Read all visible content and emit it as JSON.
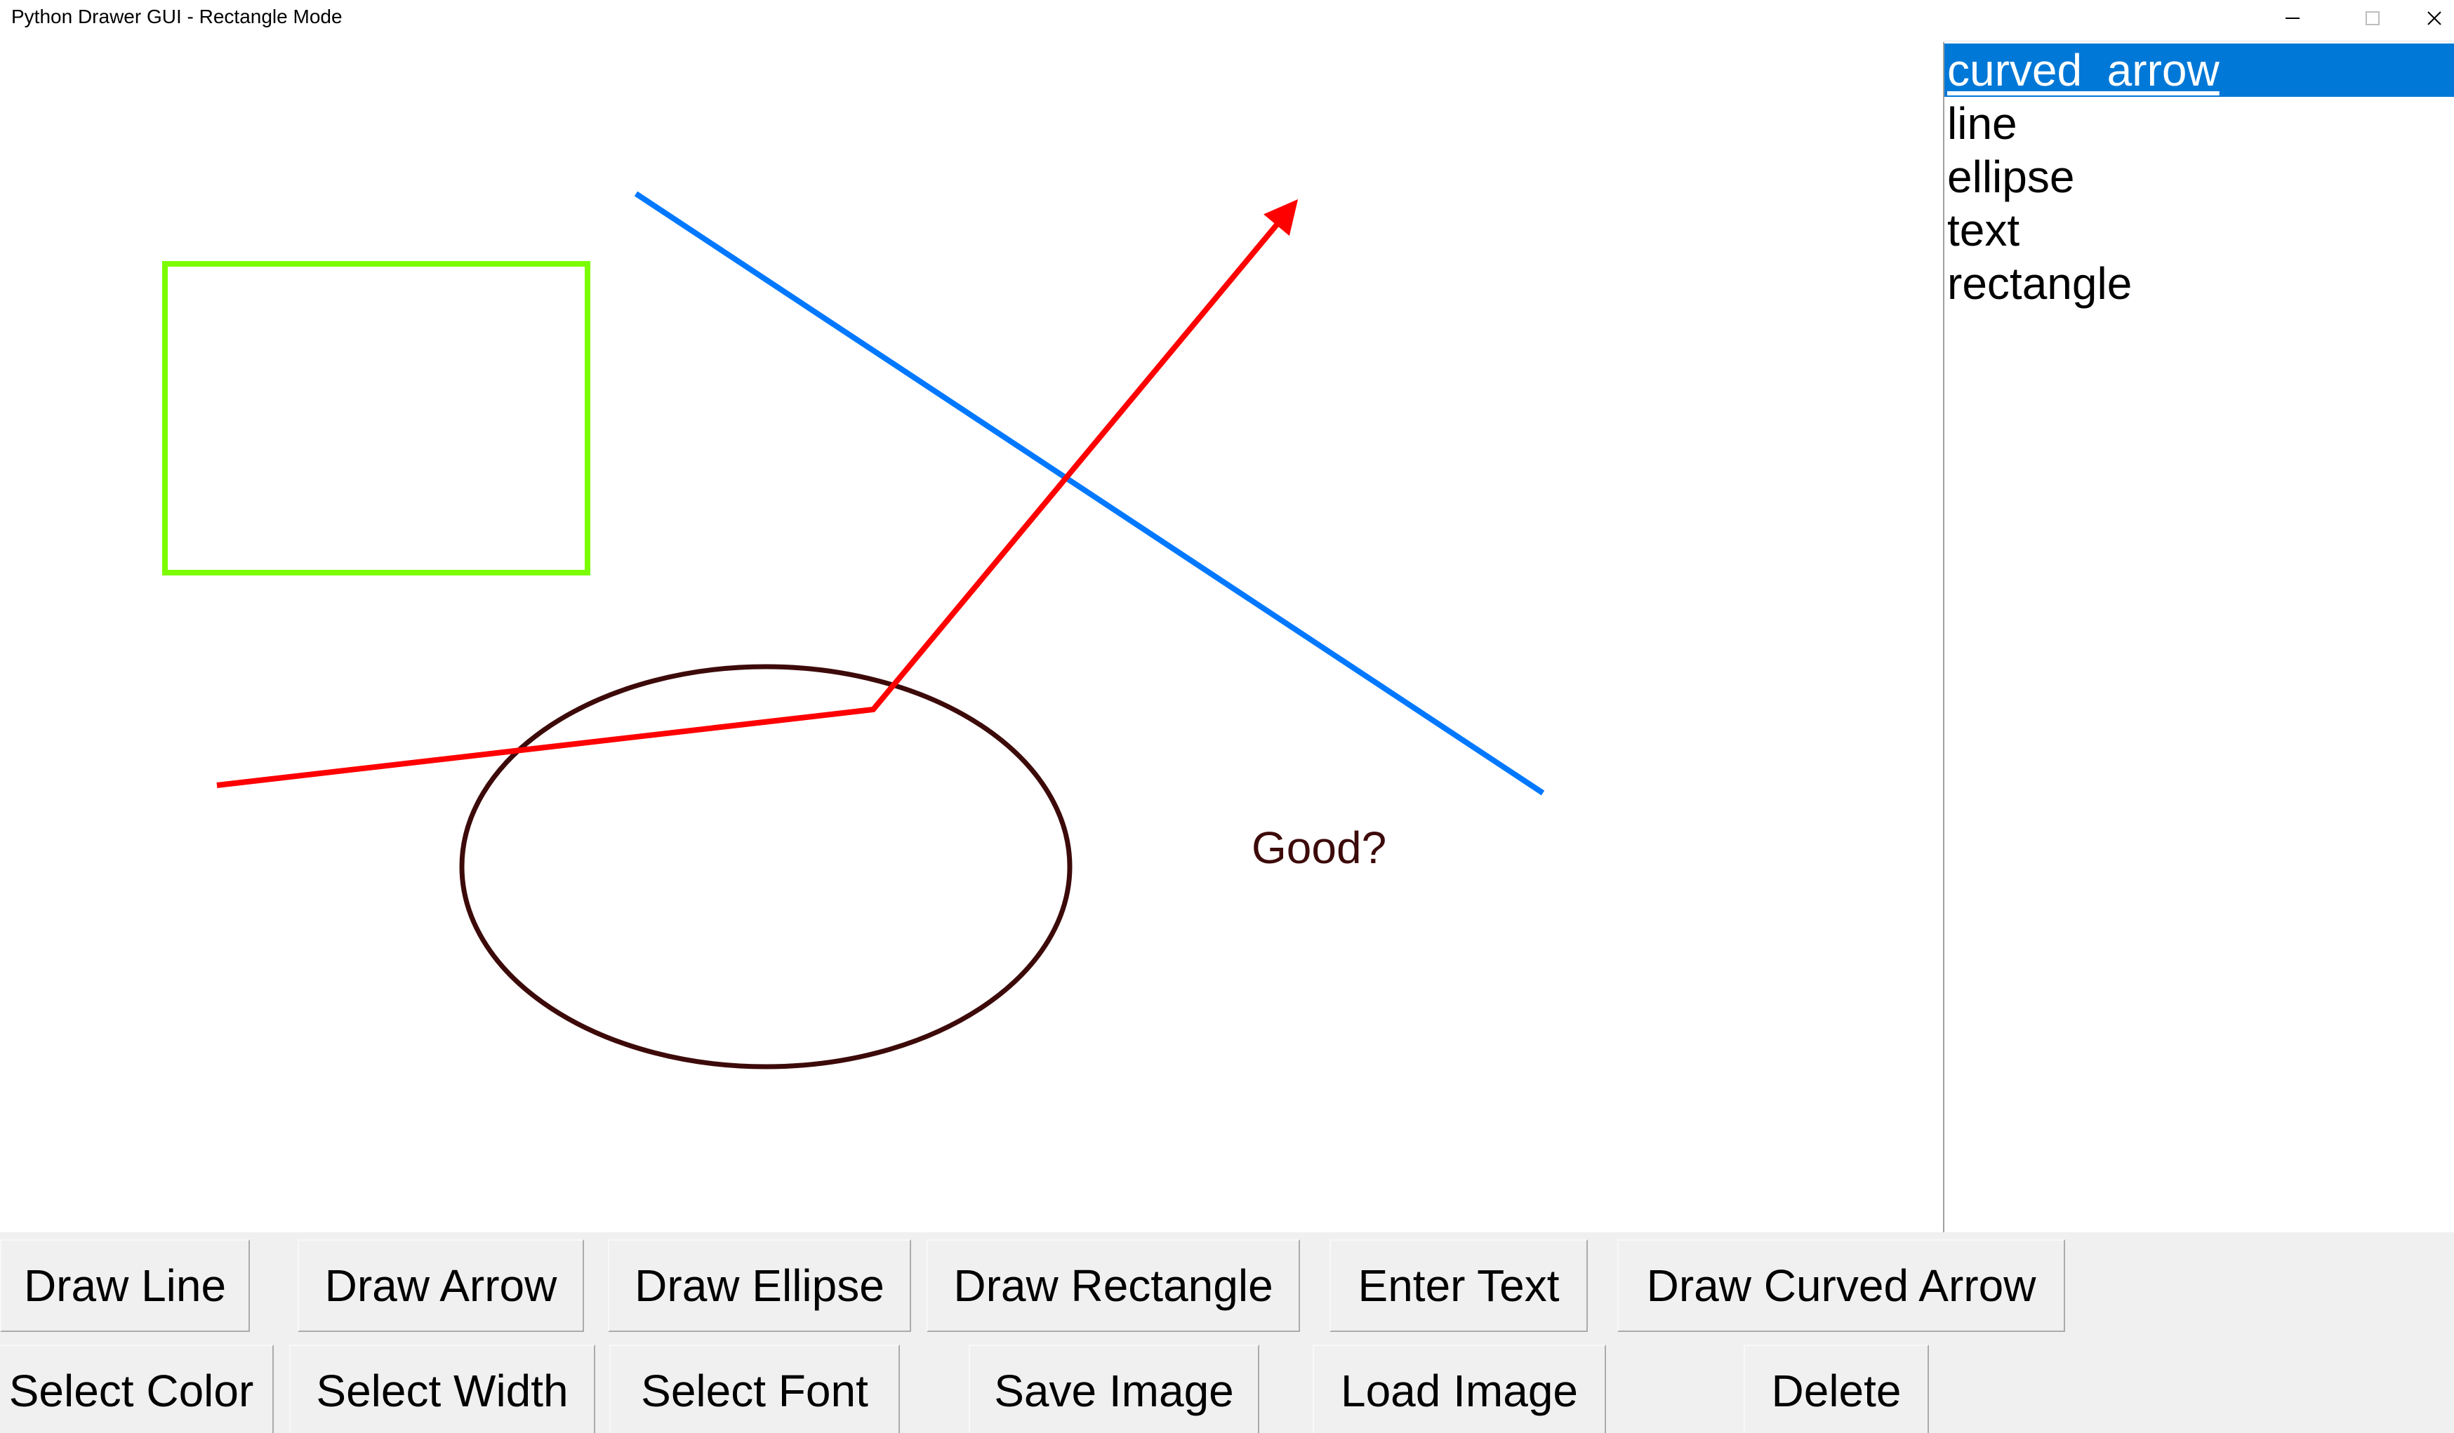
{
  "window": {
    "title": "Python Drawer GUI - Rectangle Mode",
    "controls": {
      "minimize_icon": "minimize-icon",
      "maximize_icon": "maximize-icon",
      "close_icon": "close-icon"
    }
  },
  "canvas": {
    "shapes": [
      {
        "type": "rectangle",
        "color": "#7cfc00"
      },
      {
        "type": "line",
        "color": "#0078ff"
      },
      {
        "type": "curved arrow",
        "color": "#ff0000"
      },
      {
        "type": "ellipse",
        "color": "#3d0a0a"
      },
      {
        "type": "text",
        "color": "#3d0a0a",
        "text": "Good?"
      }
    ]
  },
  "shape_list": {
    "items": [
      "curved  arrow",
      "line",
      "ellipse",
      "text",
      "rectangle"
    ],
    "selected": "curved  arrow",
    "selected_color": "#0078d7"
  },
  "toolbar": {
    "row1": {
      "draw_line": "Draw Line",
      "draw_arrow": "Draw Arrow",
      "draw_ellipse": "Draw Ellipse",
      "draw_rectangle": "Draw Rectangle",
      "enter_text": "Enter Text",
      "draw_curved_arrow": "Draw Curved Arrow"
    },
    "row2": {
      "select_color": "Select Color",
      "select_width": "Select Width",
      "select_font": "Select Font",
      "save_image": "Save Image",
      "load_image": "Load Image",
      "delete": "Delete"
    }
  }
}
